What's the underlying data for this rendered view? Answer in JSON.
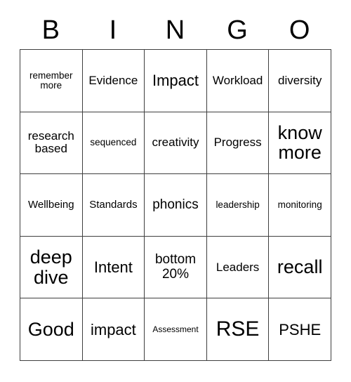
{
  "card": {
    "title": "BINGO",
    "header_letters": [
      "B",
      "I",
      "N",
      "G",
      "O"
    ],
    "columns": 5,
    "rows": 5,
    "border_color": "#3f3f3f",
    "background_color": "#ffffff",
    "text_color": "#000000",
    "cells": [
      {
        "text": "remember more",
        "size": "fs-s"
      },
      {
        "text": "Evidence",
        "size": "fs-m"
      },
      {
        "text": "Impact",
        "size": "fs-l"
      },
      {
        "text": "Workload",
        "size": "fs-m"
      },
      {
        "text": "diversity",
        "size": "fs-m"
      },
      {
        "text": "research based",
        "size": "fs-m"
      },
      {
        "text": "sequenced",
        "size": "fs-s"
      },
      {
        "text": "creativity",
        "size": "fs-m"
      },
      {
        "text": "Progress",
        "size": "fs-m"
      },
      {
        "text": "know more",
        "size": "fs-xl"
      },
      {
        "text": "Wellbeing",
        "size": "fs-sm"
      },
      {
        "text": "Standards",
        "size": "fs-sm"
      },
      {
        "text": "phonics",
        "size": "fs-ml"
      },
      {
        "text": "leadership",
        "size": "fs-s"
      },
      {
        "text": "monitoring",
        "size": "fs-s"
      },
      {
        "text": "deep dive",
        "size": "fs-xl"
      },
      {
        "text": "Intent",
        "size": "fs-l"
      },
      {
        "text": "bottom 20%",
        "size": "fs-ml"
      },
      {
        "text": "Leaders",
        "size": "fs-m"
      },
      {
        "text": "recall",
        "size": "fs-xl"
      },
      {
        "text": "Good",
        "size": "fs-xl"
      },
      {
        "text": "impact",
        "size": "fs-l"
      },
      {
        "text": "Assessment",
        "size": "fs-xs"
      },
      {
        "text": "RSE",
        "size": "fs-xxl"
      },
      {
        "text": "PSHE",
        "size": "fs-l"
      }
    ]
  }
}
